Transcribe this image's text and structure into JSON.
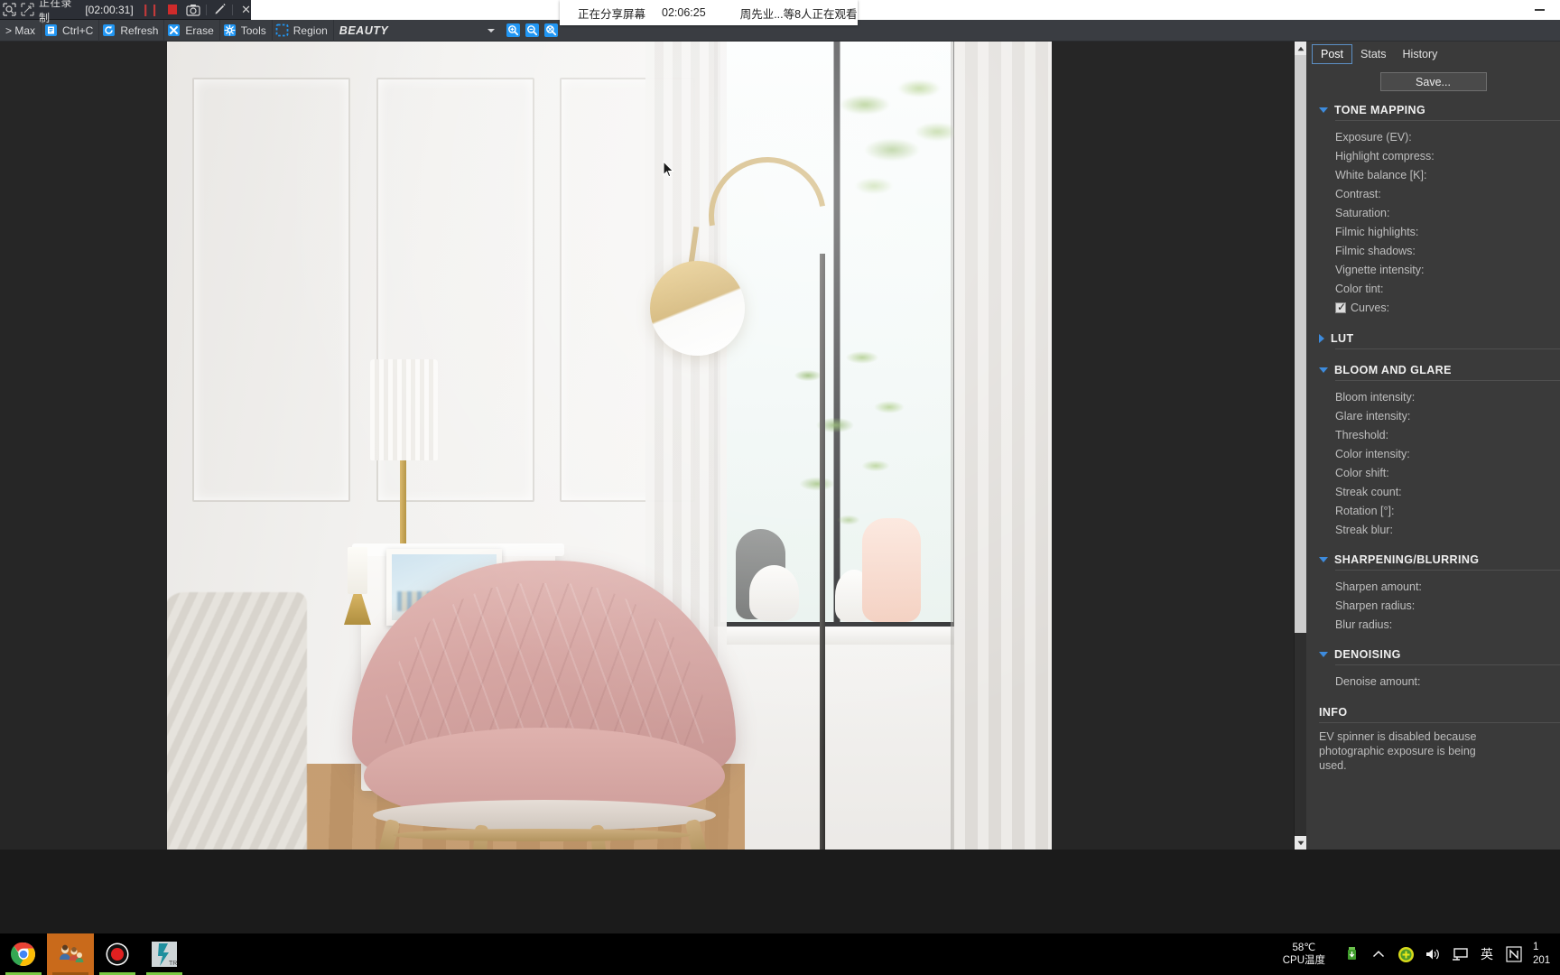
{
  "recorder": {
    "select_icon": "region-select-icon",
    "crop_icon": "crop-region-icon",
    "status": "正在录制",
    "elapsed": "[02:00:31]",
    "pause_icon": "pause-icon",
    "stop_icon": "stop-icon",
    "camera_icon": "camera-icon",
    "pen_icon": "pen-icon",
    "close_icon": "close-icon"
  },
  "share_pill": {
    "status": "正在分享屏幕",
    "timer": "02:06:25",
    "viewers": "周先业...等8人正在观看"
  },
  "window": {
    "minimize_icon": "minimize-icon"
  },
  "toolbar": {
    "items": [
      {
        "label": "> Max",
        "icon": "max-link-icon"
      },
      {
        "label": "Ctrl+C",
        "icon": "copy-icon"
      },
      {
        "label": "Refresh",
        "icon": "refresh-icon"
      },
      {
        "label": "Erase",
        "icon": "erase-icon"
      },
      {
        "label": "Tools",
        "icon": "tools-gear-icon"
      },
      {
        "label": "Region",
        "icon": "region-marquee-icon"
      }
    ],
    "pass_value": "BEAUTY",
    "pass_caret": "chevron-down-icon",
    "zoom_in_icon": "zoom-in-icon",
    "zoom_out_icon": "zoom-out-icon",
    "zoom_fit_icon": "zoom-fit-icon"
  },
  "viewport": {
    "render_name": "rendered-interior-image",
    "cursor_icon": "mouse-pointer-icon",
    "scroll_up_icon": "scroll-up-icon",
    "scroll_down_icon": "scroll-down-icon"
  },
  "right_panel": {
    "tabs": [
      {
        "label": "Post",
        "active": true
      },
      {
        "label": "Stats",
        "active": false
      },
      {
        "label": "History",
        "active": false
      }
    ],
    "save_label": "Save...",
    "sections": [
      {
        "title": "TONE MAPPING",
        "expanded": true,
        "rows": [
          {
            "label": "Exposure (EV):"
          },
          {
            "label": "Highlight compress:"
          },
          {
            "label": "White balance [K]:"
          },
          {
            "label": "Contrast:"
          },
          {
            "label": "Saturation:"
          },
          {
            "label": "Filmic highlights:"
          },
          {
            "label": "Filmic shadows:"
          },
          {
            "label": "Vignette intensity:"
          },
          {
            "label": "Color tint:"
          },
          {
            "label": "Curves:",
            "checkbox": true,
            "checked": true
          }
        ]
      },
      {
        "title": "LUT",
        "expanded": false,
        "rows": []
      },
      {
        "title": "BLOOM AND GLARE",
        "expanded": true,
        "rows": [
          {
            "label": "Bloom intensity:"
          },
          {
            "label": "Glare intensity:"
          },
          {
            "label": "Threshold:"
          },
          {
            "label": "Color intensity:"
          },
          {
            "label": "Color shift:"
          },
          {
            "label": "Streak count:"
          },
          {
            "label": "Rotation [°]:"
          },
          {
            "label": "Streak blur:"
          }
        ]
      },
      {
        "title": "SHARPENING/BLURRING",
        "expanded": true,
        "rows": [
          {
            "label": "Sharpen amount:"
          },
          {
            "label": "Sharpen radius:"
          },
          {
            "label": "Blur radius:"
          }
        ]
      },
      {
        "title": "DENOISING",
        "expanded": true,
        "rows": [
          {
            "label": "Denoise amount:"
          }
        ]
      }
    ],
    "info_title": "INFO",
    "info_lines": [
      "EV spinner is disabled because",
      "photographic exposure is being",
      "used."
    ]
  },
  "taskbar": {
    "apps": [
      {
        "name": "chrome-taskbar-icon",
        "active": false
      },
      {
        "name": "qq-taskbar-icon",
        "active": true
      },
      {
        "name": "recorder-taskbar-icon",
        "active": false
      },
      {
        "name": "renderer-taskbar-icon",
        "active": false
      }
    ],
    "cpu_temp": "58℃",
    "cpu_label": "CPU温度",
    "tray_icons": [
      "usb-eject-icon",
      "show-hidden-icons-icon",
      "update-shield-icon",
      "volume-icon",
      "display-icon",
      "ime-english-icon",
      "onenote-icon"
    ],
    "clock_time": "1",
    "clock_date": "201"
  }
}
